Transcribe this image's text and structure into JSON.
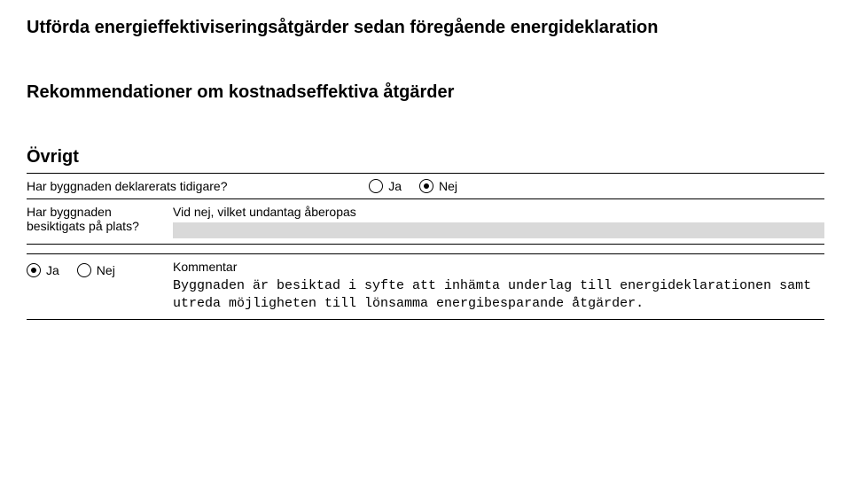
{
  "headings": {
    "performed": "Utförda energieffektiviseringsåtgärder sedan föregående energideklaration",
    "recommendations": "Rekommendationer om kostnadseffektiva åtgärder",
    "other": "Övrigt"
  },
  "q1": {
    "label": "Har byggnaden deklarerats tidigare?",
    "yes": "Ja",
    "no": "Nej",
    "selected": "no"
  },
  "q2": {
    "label": "Har byggnaden besiktigats på plats?",
    "sublabel": "Vid nej, vilket undantag åberopas",
    "value": ""
  },
  "q3": {
    "yes": "Ja",
    "no": "Nej",
    "selected": "yes",
    "comment_label": "Kommentar",
    "comment_text": "Byggnaden är besiktad i syfte att inhämta underlag till energideklarationen samt utreda möjligheten till lönsamma energibesparande åtgärder."
  }
}
